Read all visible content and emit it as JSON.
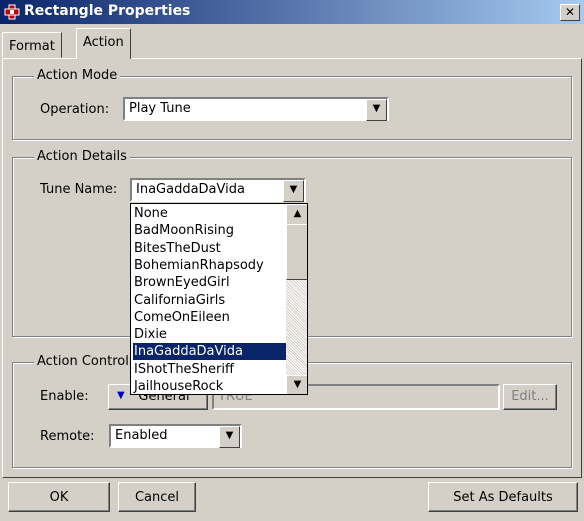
{
  "window": {
    "title": "Rectangle Properties",
    "close_glyph": "✕"
  },
  "tabs": [
    {
      "label": "Format"
    },
    {
      "label": "Action",
      "selected": true
    }
  ],
  "action_mode": {
    "legend": "Action Mode",
    "operation_label": "Operation:",
    "operation_value": "Play Tune"
  },
  "action_details": {
    "legend": "Action Details",
    "tune_label": "Tune Name:",
    "tune_value": "InaGaddaDaVida",
    "options": [
      "None",
      "BadMoonRising",
      "BitesTheDust",
      "BohemianRhapsody",
      "BrownEyedGirl",
      "CaliforniaGirls",
      "ComeOnEileen",
      "Dixie",
      "InaGaddaDaVida",
      "IShotTheSheriff",
      "JailhouseRock"
    ],
    "selected_index": 8
  },
  "action_control": {
    "legend": "Action Control",
    "enable_label": "Enable:",
    "general_button": "General",
    "enable_value": "TRUE",
    "edit_button": "Edit...",
    "remote_label": "Remote:",
    "remote_value": "Enabled"
  },
  "footer": {
    "ok": "OK",
    "cancel": "Cancel",
    "set_defaults": "Set As Defaults"
  },
  "colors": {
    "title_start": "#0a246a",
    "title_end": "#a6caf0",
    "selection": "#0a246a",
    "face": "#d4d0c8"
  },
  "icons": {
    "window": "rectangle-properties-icon",
    "dropdown": "chevron-down-icon"
  }
}
